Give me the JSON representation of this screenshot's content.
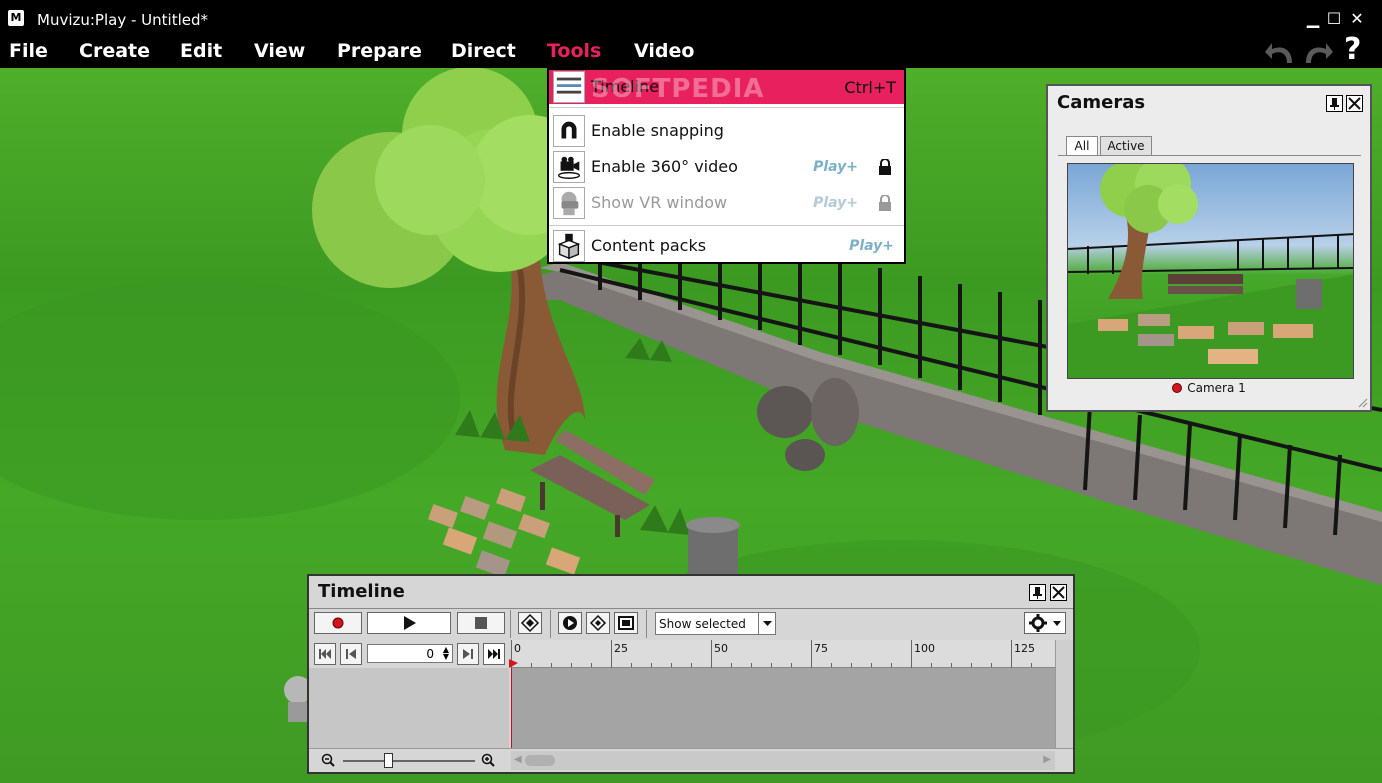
{
  "window": {
    "title": "Muvizu:Play - Untitled*",
    "icon_text": "M",
    "controls": {
      "minimize": "▁",
      "maximize": "☐",
      "close": "✕"
    }
  },
  "menubar": {
    "items": [
      "File",
      "Create",
      "Edit",
      "View",
      "Prepare",
      "Direct",
      "Tools",
      "Video"
    ],
    "active": "Tools",
    "help_label": "?"
  },
  "colors": {
    "accent": "#e8205e",
    "play_badge": "#7ab0c8",
    "record": "#d3151e"
  },
  "tools_menu": {
    "items": [
      {
        "label": "Timeline",
        "shortcut": "Ctrl+T",
        "icon": "timeline-icon",
        "highlighted": true
      },
      {
        "label": "Enable snapping",
        "icon": "magnet-icon"
      },
      {
        "label": "Enable 360° video",
        "icon": "camera-360-icon",
        "badge": "Play+",
        "locked": true
      },
      {
        "label": "Show VR window",
        "icon": "vr-headset-icon",
        "badge": "Play+",
        "locked": true,
        "disabled": true
      },
      {
        "label": "Content packs",
        "icon": "content-box-icon",
        "badge": "Play+"
      }
    ],
    "watermark": "SOFTPEDIA"
  },
  "cameras_panel": {
    "title": "Cameras",
    "tabs": [
      "All",
      "Active"
    ],
    "active_tab": "All",
    "camera_name": "Camera 1"
  },
  "timeline_panel": {
    "title": "Timeline",
    "filter_value": "Show selected",
    "frame_value": "0",
    "ruler_labels": [
      "0",
      "25",
      "50",
      "75",
      "100",
      "125"
    ]
  }
}
